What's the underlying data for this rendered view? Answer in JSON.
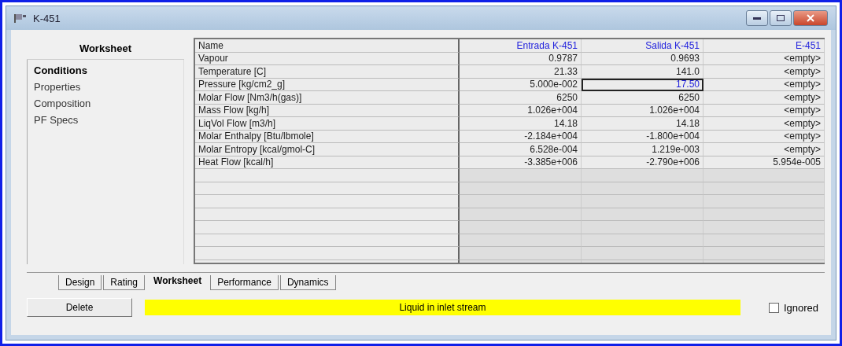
{
  "window": {
    "title": "K-451"
  },
  "sidebar": {
    "heading": "Worksheet",
    "items": [
      {
        "label": "Conditions",
        "selected": true
      },
      {
        "label": "Properties",
        "selected": false
      },
      {
        "label": "Composition",
        "selected": false
      },
      {
        "label": "PF Specs",
        "selected": false
      }
    ]
  },
  "table": {
    "columns": [
      "Name",
      "Entrada K-451",
      "Salida K-451",
      "E-451"
    ],
    "rows": [
      {
        "cells": [
          {
            "text": "Vapour",
            "selected": false
          },
          {
            "text": "0.9787",
            "selected": false
          },
          {
            "text": "0.9693",
            "selected": false
          },
          {
            "text": "<empty>",
            "selected": false
          }
        ]
      },
      {
        "cells": [
          {
            "text": "Temperature [C]",
            "selected": false
          },
          {
            "text": "21.33",
            "selected": false
          },
          {
            "text": "141.0",
            "selected": false
          },
          {
            "text": "<empty>",
            "selected": false
          }
        ]
      },
      {
        "cells": [
          {
            "text": "Pressure [kg/cm2_g]",
            "selected": false
          },
          {
            "text": "5.000e-002",
            "selected": false
          },
          {
            "text": "17.50",
            "selected": true
          },
          {
            "text": "<empty>",
            "selected": false
          }
        ]
      },
      {
        "cells": [
          {
            "text": "Molar Flow [Nm3/h(gas)]",
            "selected": false
          },
          {
            "text": "6250",
            "selected": false
          },
          {
            "text": "6250",
            "selected": false
          },
          {
            "text": "<empty>",
            "selected": false
          }
        ]
      },
      {
        "cells": [
          {
            "text": "Mass Flow [kg/h]",
            "selected": false
          },
          {
            "text": "1.026e+004",
            "selected": false
          },
          {
            "text": "1.026e+004",
            "selected": false
          },
          {
            "text": "<empty>",
            "selected": false
          }
        ]
      },
      {
        "cells": [
          {
            "text": "LiqVol Flow [m3/h]",
            "selected": false
          },
          {
            "text": "14.18",
            "selected": false
          },
          {
            "text": "14.18",
            "selected": false
          },
          {
            "text": "<empty>",
            "selected": false
          }
        ]
      },
      {
        "cells": [
          {
            "text": "Molar Enthalpy [Btu/lbmole]",
            "selected": false
          },
          {
            "text": "-2.184e+004",
            "selected": false
          },
          {
            "text": "-1.800e+004",
            "selected": false
          },
          {
            "text": "<empty>",
            "selected": false
          }
        ]
      },
      {
        "cells": [
          {
            "text": "Molar Entropy [kcal/gmol-C]",
            "selected": false
          },
          {
            "text": "6.528e-004",
            "selected": false
          },
          {
            "text": "1.219e-003",
            "selected": false
          },
          {
            "text": "<empty>",
            "selected": false
          }
        ]
      },
      {
        "cells": [
          {
            "text": "Heat Flow [kcal/h]",
            "selected": false
          },
          {
            "text": "-3.385e+006",
            "selected": false
          },
          {
            "text": "-2.790e+006",
            "selected": false
          },
          {
            "text": "5.954e-005",
            "selected": false
          }
        ]
      }
    ]
  },
  "tabs": [
    {
      "label": "Design",
      "selected": false
    },
    {
      "label": "Rating",
      "selected": false
    },
    {
      "label": "Worksheet",
      "selected": true
    },
    {
      "label": "Performance",
      "selected": false
    },
    {
      "label": "Dynamics",
      "selected": false
    }
  ],
  "footer": {
    "delete_button": "Delete",
    "status": "Liquid in inlet stream",
    "ignored": {
      "label": "Ignored",
      "checked": false
    }
  }
}
